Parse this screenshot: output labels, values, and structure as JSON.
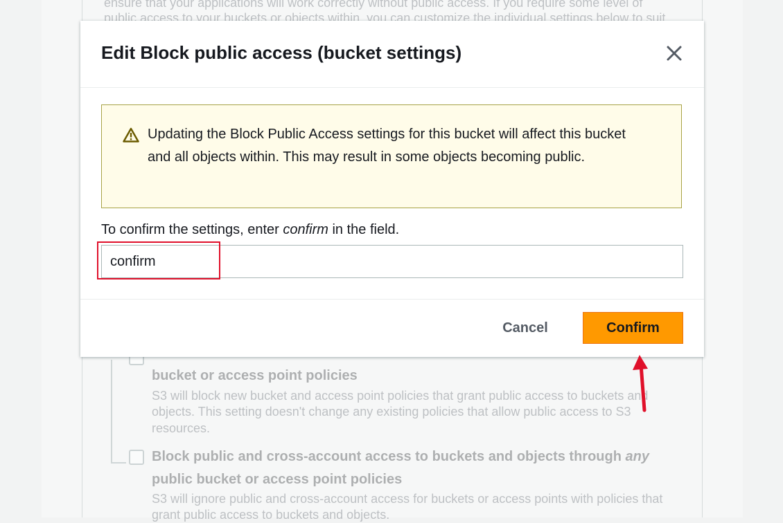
{
  "background": {
    "top_text_line1": "ensure that your applications will work correctly without public access. If you require some level of",
    "top_text_line2": "public access to your buckets or objects within, you can customize the individual settings below to suit",
    "policy_title_cont": "bucket or access point policies",
    "policy_desc_line1": "S3 will block new bucket and access point policies that grant public access to buckets and",
    "policy_desc_line2": "objects. This setting doesn't change any existing policies that allow public access to S3",
    "policy_desc_line3": "resources.",
    "cross_title_line1_a": "Block public and cross-account access to buckets and objects through ",
    "cross_title_line1_em": "any",
    "cross_title_line2": "public bucket or access point policies",
    "cross_desc_line1": "S3 will ignore public and cross-account access for buckets or access points with policies that",
    "cross_desc_line2": "grant public access to buckets and objects."
  },
  "modal": {
    "title": "Edit Block public access (bucket settings)",
    "close_icon": "close-icon",
    "alert": {
      "icon": "warning-icon",
      "text": "Updating the Block Public Access settings for this bucket will affect this bucket and all objects within. This may result in some objects becoming public."
    },
    "confirm_label_prefix": "To confirm the settings, enter ",
    "confirm_label_keyword": "confirm",
    "confirm_label_suffix": " in the field.",
    "confirm_input_value": "confirm",
    "cancel_label": "Cancel",
    "confirm_label": "Confirm"
  },
  "colors": {
    "primary_button": "#ff9900",
    "warning_bg": "#fffce9",
    "warning_border": "#a7a245",
    "annotation": "#e0102a"
  }
}
